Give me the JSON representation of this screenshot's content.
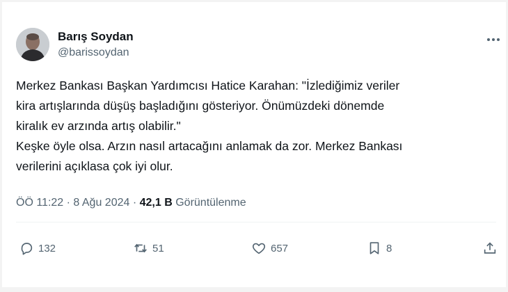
{
  "author": {
    "name": "Barış Soydan",
    "handle": "@barissoydan"
  },
  "tweet": {
    "lines": [
      "Merkez Bankası Başkan Yardımcısı Hatice Karahan: \"İzlediğimiz veriler",
      "kira artışlarında düşüş başladığını gösteriyor. Önümüzdeki dönemde",
      "kiralık ev arzında artış olabilir.\"",
      "Keşke öyle olsa. Arzın nasıl artacağını anlamak da zor. Merkez Bankası",
      "verilerini açıklasa çok iyi olur."
    ]
  },
  "meta": {
    "time": "ÖÖ 11:22",
    "date": "8 Ağu 2024",
    "dot": "·",
    "views_count": "42,1 B",
    "views_label": "Görüntülenme"
  },
  "actions": {
    "replies": "132",
    "retweets": "51",
    "likes": "657",
    "bookmarks": "8"
  },
  "icons": {
    "more": "more-horizontal-icon",
    "reply": "reply-icon",
    "retweet": "retweet-icon",
    "like": "heart-icon",
    "bookmark": "bookmark-icon",
    "share": "share-icon"
  },
  "colors": {
    "text": "#0f1419",
    "secondary": "#536471",
    "background": "#f3f3f3"
  }
}
